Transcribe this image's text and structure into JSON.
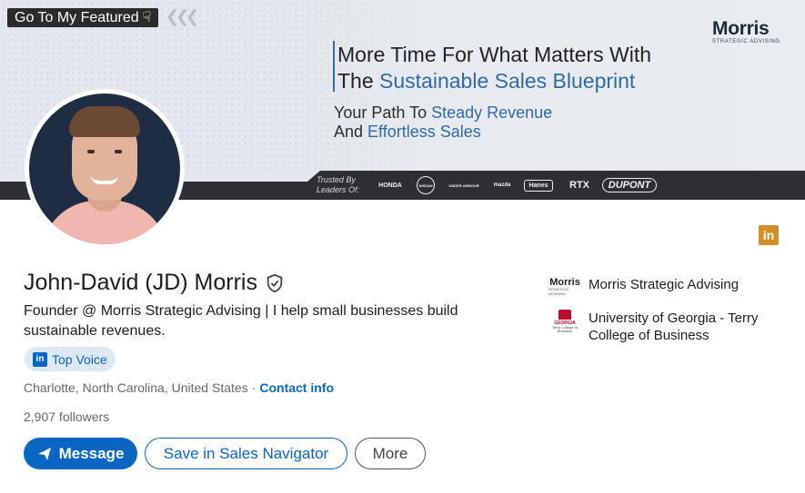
{
  "banner": {
    "featured_tag": "Go To My Featured",
    "brand_name": "Morris",
    "brand_sub": "STRATEGIC ADVISING",
    "headline_line1": "More Time For What Matters With",
    "headline_line2_prefix": "The ",
    "headline_line2_highlight": "Sustainable Sales Blueprint",
    "sub_line1_prefix": "Your Path To ",
    "sub_line1_highlight": "Steady Revenue",
    "sub_line2_prefix": "And ",
    "sub_line2_highlight": "Effortless Sales",
    "trusted_label_1": "Trusted By",
    "trusted_label_2": "Leaders Of:",
    "logos": [
      "HONDA",
      "NISSAN",
      "UNDER ARMOUR",
      "mazda",
      "Hanes",
      "RTX",
      "DUPONT"
    ]
  },
  "profile": {
    "name": "John-David (JD) Morris",
    "headline": "Founder @ Morris Strategic Advising | I help small businesses build sustainable revenues.",
    "badge": "Top Voice",
    "location": "Charlotte, North Carolina, United States",
    "separator": "·",
    "contact_link": "Contact info",
    "followers": "2,907 followers"
  },
  "actions": {
    "message": "Message",
    "save_sales_nav": "Save in Sales Navigator",
    "more": "More"
  },
  "orgs": {
    "company": "Morris Strategic Advising",
    "company_logo_name": "Morris",
    "company_logo_sub": "STRATEGIC ADVISING",
    "school": "University of Georgia - Terry College of Business",
    "school_logo_name": "GEORGIA",
    "school_logo_sub": "Terry College of Business"
  },
  "colors": {
    "linkedin_blue": "#0a66c2",
    "banner_blue": "#2e6aa8",
    "li_badge": "#d18f26",
    "uga_red": "#ba0c2f"
  },
  "icons": [
    "verified-shield-icon",
    "linkedin-icon",
    "send-icon",
    "pointing-hand-icon"
  ]
}
